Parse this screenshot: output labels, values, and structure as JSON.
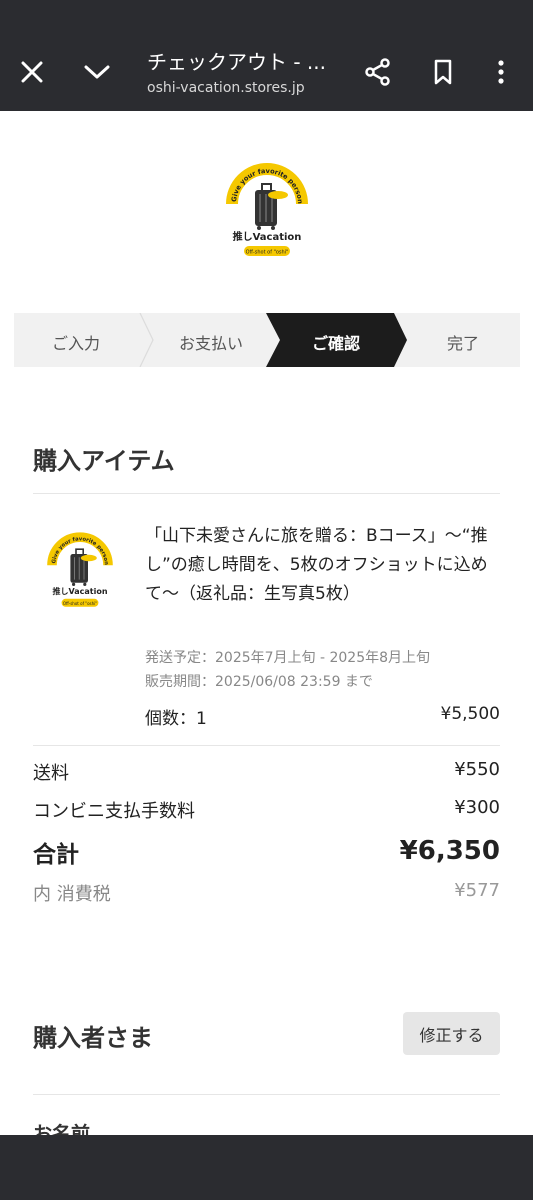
{
  "browser": {
    "title": "チェックアウト - ...",
    "url": "oshi-vacation.stores.jp",
    "icons": [
      "close-icon",
      "chevron-down-icon",
      "share-icon",
      "bookmark-icon",
      "more-vert-icon"
    ]
  },
  "brand": {
    "arc_text": "Give your favorite person a holiday!",
    "name": "推しVacation",
    "tagline": "Off-shot of \"oshi\"",
    "accent": "#f5c800"
  },
  "steps": {
    "items": [
      {
        "label": "ご入力",
        "active": false
      },
      {
        "label": "お支払い",
        "active": false
      },
      {
        "label": "ご確認",
        "active": true
      },
      {
        "label": "完了",
        "active": false
      }
    ],
    "active_color": "#1c1c1c"
  },
  "purchase": {
    "title": "購入アイテム",
    "item": {
      "name": "「山下未愛さんに旅を贈る：Bコース」〜“推し”の癒し時間を、5枚のオフショットに込めて〜（返礼品：生写真5枚）",
      "shipping_schedule": "発送予定：2025年7月上旬 - 2025年8月上旬",
      "sale_period": "販売期間：2025/06/08 23:59 まで",
      "quantity_label": "個数：1",
      "price": "¥5,500"
    },
    "shipping_label": "送料",
    "shipping_value": "¥550",
    "fee_label": "コンビニ支払手数料",
    "fee_value": "¥300",
    "total_label": "合計",
    "total_value": "¥6,350",
    "tax_label": "内 消費税",
    "tax_value": "¥577"
  },
  "buyer": {
    "title": "購入者さま",
    "edit_label": "修正する",
    "name_label": "お名前"
  }
}
